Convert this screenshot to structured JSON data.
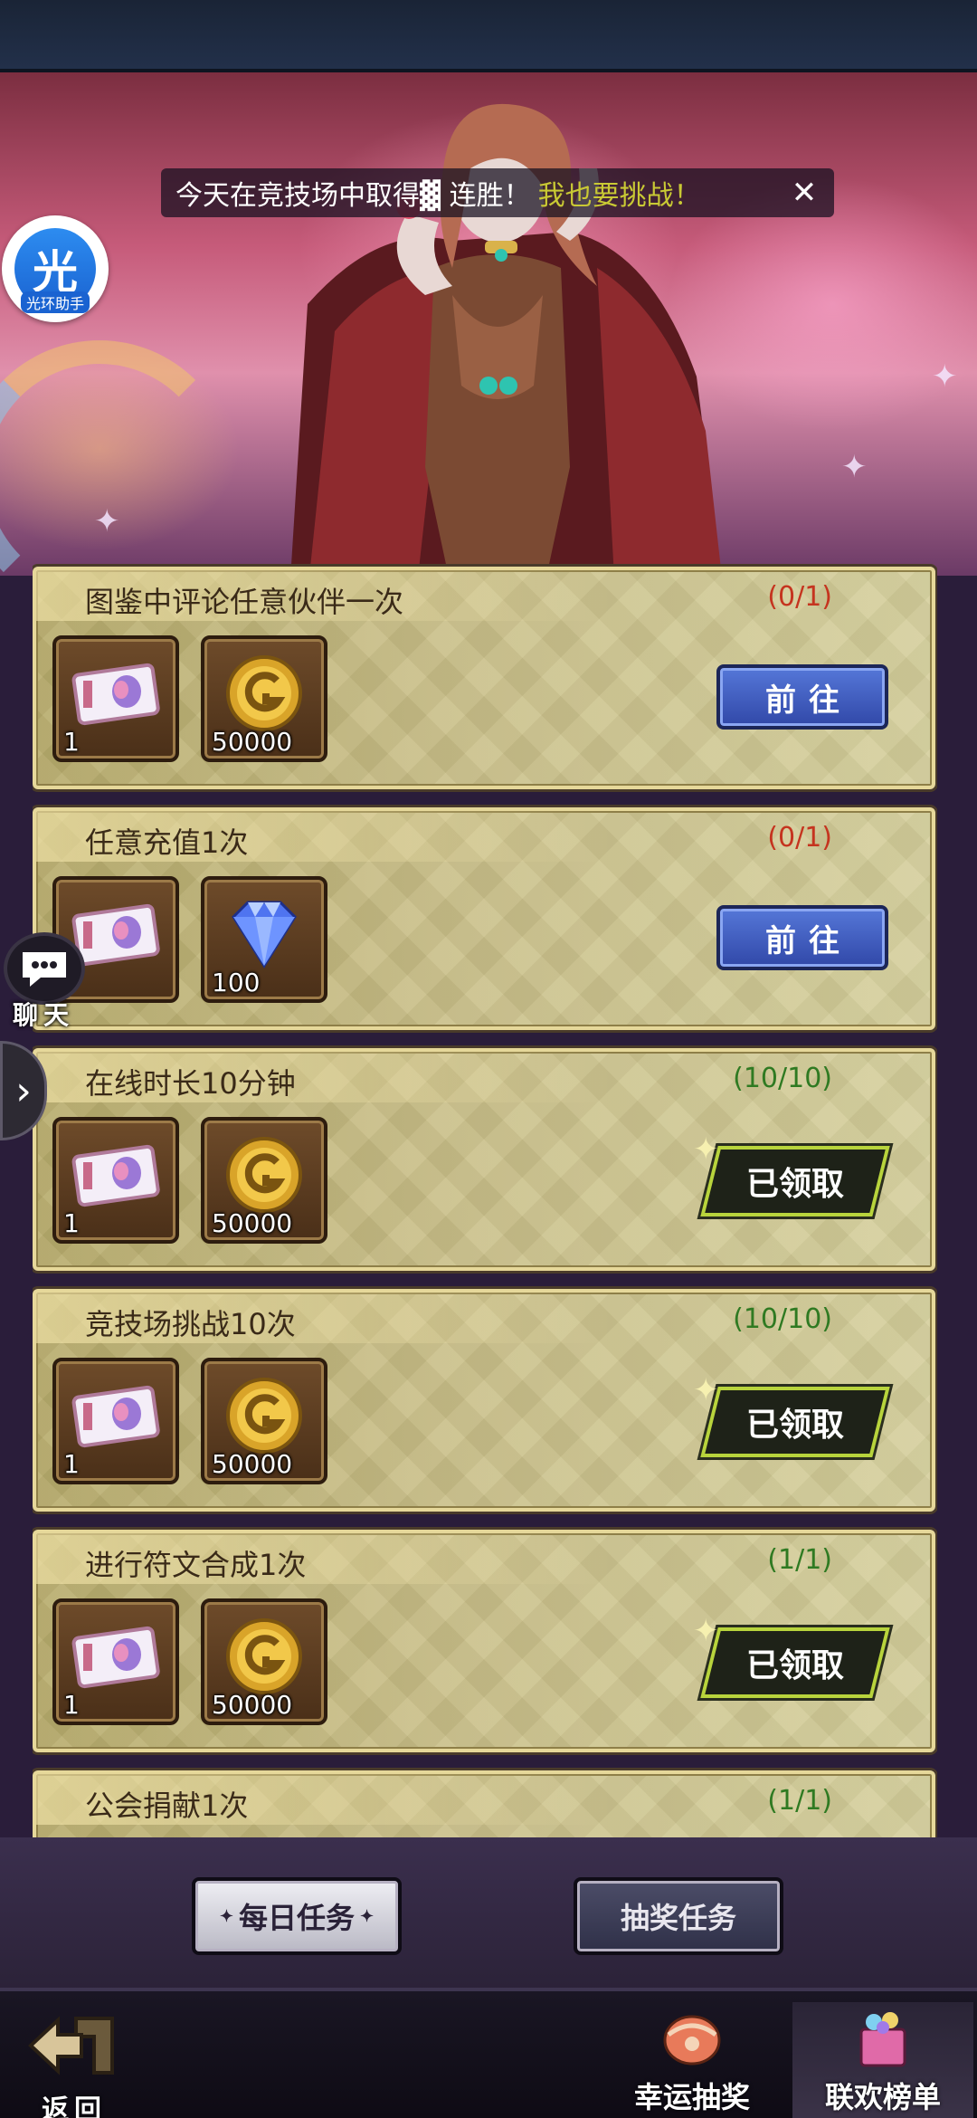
{
  "ticker": {
    "message": "今天在竞技场中取得▓ 连胜！",
    "link": "我也要挑战！"
  },
  "assistant": {
    "glyph": "光",
    "caption": "光环助手"
  },
  "side": {
    "chat_label": "聊天"
  },
  "tasks": [
    {
      "title": "图鉴中评论任意伙伴一次",
      "progress": "(0/1)",
      "status": "todo",
      "rewards": [
        {
          "icon": "ticket-icon",
          "qty": "1"
        },
        {
          "icon": "gold-coin-icon",
          "qty": "50000"
        }
      ],
      "action_label": "前往"
    },
    {
      "title": "任意充值1次",
      "progress": "(0/1)",
      "status": "todo",
      "rewards": [
        {
          "icon": "ticket-icon",
          "qty": ""
        },
        {
          "icon": "diamond-icon",
          "qty": "100"
        }
      ],
      "action_label": "前往"
    },
    {
      "title": "在线时长10分钟",
      "progress": "(10/10)",
      "status": "done",
      "rewards": [
        {
          "icon": "ticket-icon",
          "qty": "1"
        },
        {
          "icon": "gold-coin-icon",
          "qty": "50000"
        }
      ],
      "action_label": "已领取"
    },
    {
      "title": "竞技场挑战10次",
      "progress": "(10/10)",
      "status": "done",
      "rewards": [
        {
          "icon": "ticket-icon",
          "qty": "1"
        },
        {
          "icon": "gold-coin-icon",
          "qty": "50000"
        }
      ],
      "action_label": "已领取"
    },
    {
      "title": "进行符文合成1次",
      "progress": "(1/1)",
      "status": "done",
      "rewards": [
        {
          "icon": "ticket-icon",
          "qty": "1"
        },
        {
          "icon": "gold-coin-icon",
          "qty": "50000"
        }
      ],
      "action_label": "已领取"
    },
    {
      "title": "公会捐献1次",
      "progress": "(1/1)",
      "status": "done",
      "rewards": [
        {
          "icon": "ticket-icon",
          "qty": ""
        },
        {
          "icon": "gold-coin-icon",
          "qty": ""
        }
      ],
      "action_label": ""
    }
  ],
  "tabs": {
    "daily": "每日任务",
    "lottery_tasks": "抽奖任务"
  },
  "footer": {
    "back": "返回",
    "lucky_draw": "幸运抽奖",
    "ranking": "联欢榜单"
  },
  "colors": {
    "todo_progress": "#c5341f",
    "done_progress": "#2f7a22",
    "go_button": "#3d5cc4",
    "claimed_border": "#b8d43c",
    "ticker_link": "#c9c934"
  }
}
